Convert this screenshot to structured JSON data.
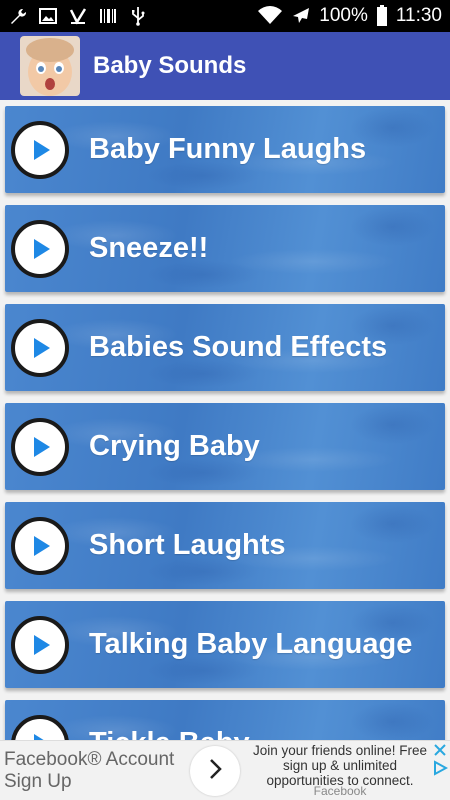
{
  "status_bar": {
    "battery_percent": "100%",
    "time": "11:30"
  },
  "app_bar": {
    "title": "Baby Sounds"
  },
  "sounds": [
    {
      "label": "Baby Funny Laughs"
    },
    {
      "label": "Sneeze!!"
    },
    {
      "label": "Babies Sound Effects"
    },
    {
      "label": "Crying Baby"
    },
    {
      "label": "Short Laughts"
    },
    {
      "label": "Talking Baby Language"
    },
    {
      "label": "Tickle Baby"
    }
  ],
  "ad": {
    "title": "Facebook® Account Sign Up",
    "body": "Join your friends online! Free sign up & unlimited opportunities to connect.",
    "source": "Facebook"
  },
  "colors": {
    "app_bar": "#3f51b5",
    "item_blue": "#4585cc",
    "play_triangle": "#1e88e5"
  }
}
